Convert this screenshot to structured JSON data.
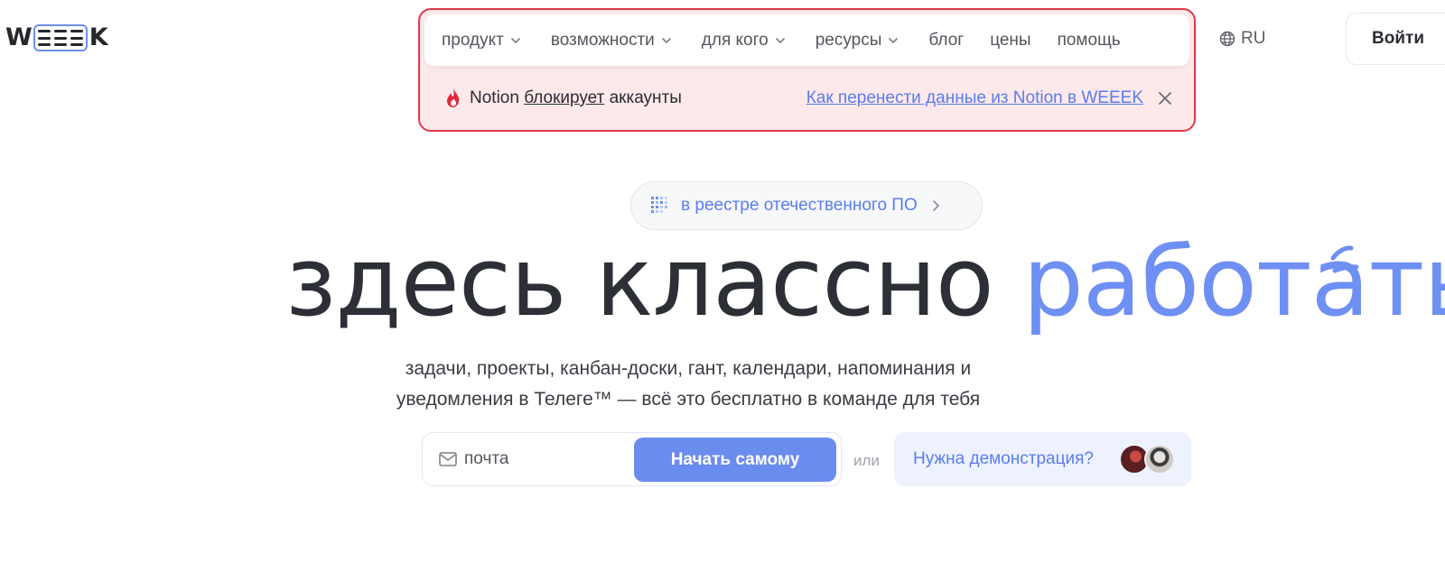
{
  "logo": {
    "text_w": "W",
    "text_k": "K",
    "brand": "WEEEK"
  },
  "nav": {
    "items": [
      {
        "label": "продукт",
        "has_dropdown": true
      },
      {
        "label": "возможности",
        "has_dropdown": true
      },
      {
        "label": "для кого",
        "has_dropdown": true
      },
      {
        "label": "ресурсы",
        "has_dropdown": true
      },
      {
        "label": "блог",
        "has_dropdown": false
      },
      {
        "label": "цены",
        "has_dropdown": false
      },
      {
        "label": "помощь",
        "has_dropdown": false
      }
    ],
    "language": "RU",
    "login_label": "Войти"
  },
  "banner": {
    "text_before": "Notion ",
    "text_underlined": "блокирует",
    "text_after": " аккаунты",
    "link_text": "Как перенести данные из Notion в WEEEK",
    "icon": "fire-icon"
  },
  "registry_pill": {
    "label": "в реестре отечественного ПО"
  },
  "hero": {
    "title_main": "здесь классно ",
    "title_accent": "работать",
    "subtitle_line1": "задачи, проекты, канбан-доски, гант, календари, напоминания и",
    "subtitle_line2": "уведомления в Телеге™ — всё это бесплатно в команде для тебя"
  },
  "cta": {
    "email_placeholder": "почта",
    "start_button": "Начать самому",
    "or_text": "или",
    "demo_label": "Нужна демонстрация?"
  },
  "colors": {
    "accent": "#6b8cef",
    "link": "#5a7df0",
    "outline": "#e03a4c",
    "banner_bg": "#fde8ea",
    "text": "#2b2d33"
  }
}
